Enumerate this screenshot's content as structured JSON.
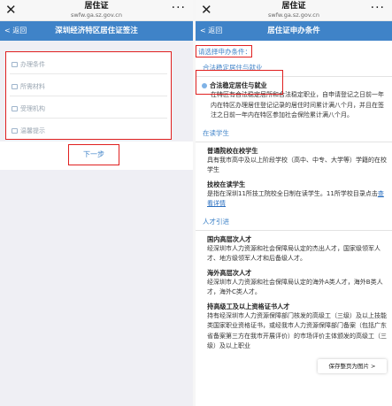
{
  "left": {
    "title": "居住证",
    "url": "swfw.ga.sz.gov.cn",
    "nav_back": "返回",
    "nav_title": "深圳经济特区居住证签注",
    "fields": [
      "办理条件",
      "所需材料",
      "受理机构",
      "温馨提示"
    ],
    "next_label": "下一步"
  },
  "right": {
    "title": "居住证",
    "url": "swfw.ga.sz.gov.cn",
    "nav_back": "返回",
    "nav_title": "居住证申办条件",
    "hint": "请选择申办条件：",
    "sections": [
      {
        "name": "合法稳定居住与就业",
        "items": [
          {
            "title": "合法稳定居住与就业",
            "desc": "在特区有合法稳定居所和合法稳定职业，自申请登记之日前一年内在特区办理居住登记记录的居住时间累计满八个月，并且在签注之日前一年内在特区参加社会保险累计满八个月。"
          }
        ]
      },
      {
        "name": "在读学生",
        "items": [
          {
            "title": "普通院校在校学生",
            "desc": "具有我市高中及以上阶段学校（高中、中专、大学等）学籍的在校学生"
          },
          {
            "title": "技校在读学生",
            "desc": "是指在深圳11所技工院校全日制在读学生。11所学校目录点击",
            "link": "查看详情"
          }
        ]
      },
      {
        "name": "人才引进",
        "items": [
          {
            "title": "国内高层次人才",
            "desc": "经深圳市人力资源和社会保障局认定的杰出人才，国家级领军人才、地方级领军人才和后备级人才。"
          },
          {
            "title": "海外高层次人才",
            "desc": "经深圳市人力资源和社会保障局认定的海外A类人才，海外B类人才，海外C类人才。"
          },
          {
            "title": "持高级工及以上资格证书人才",
            "desc": "持有经深圳市人力资源保障部门核发的高级工（三级）及以上技能类国家职业资格证书，或经我市人力资源保障部门备案（包括广东省备案第三方在我市开展评价）的市场评价主体颁发的高级工（三级）及以上职业"
          }
        ]
      }
    ],
    "save_label": "保存整页为图片 >"
  },
  "colors": {
    "accent": "#3f83c8",
    "highlight_box": "#e02020"
  }
}
